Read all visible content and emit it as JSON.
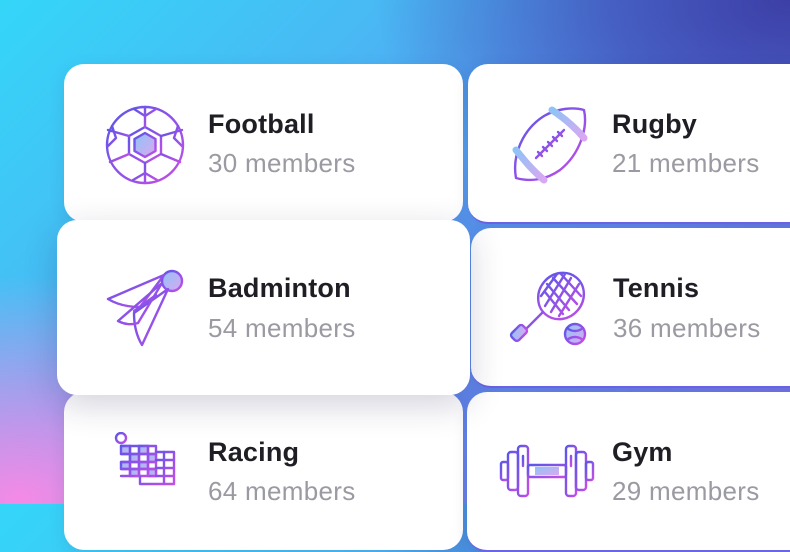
{
  "colors": {
    "gradient_start": "#7a4cf0",
    "gradient_end": "#c04ee8"
  },
  "groups": [
    {
      "name": "Football",
      "members": "30 members",
      "icon": "football-icon"
    },
    {
      "name": "Rugby",
      "members": "21 members",
      "icon": "rugby-ball-icon"
    },
    {
      "name": "Badminton",
      "members": "54 members",
      "icon": "shuttlecock-icon"
    },
    {
      "name": "Tennis",
      "members": "36 members",
      "icon": "tennis-racket-icon"
    },
    {
      "name": "Racing",
      "members": "64 members",
      "icon": "checkered-flag-icon"
    },
    {
      "name": "Gym",
      "members": "29 members",
      "icon": "dumbbell-icon"
    }
  ]
}
